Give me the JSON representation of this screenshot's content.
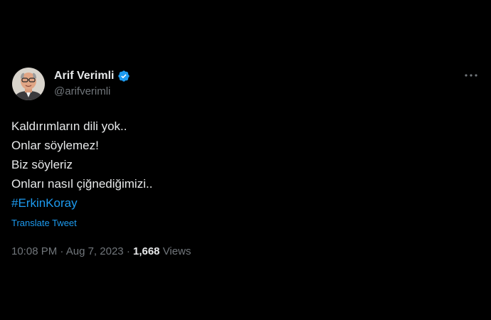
{
  "author": {
    "display_name": "Arif Verimli",
    "handle": "@arifverimli",
    "verified_icon": "verified-badge-icon",
    "verified_color": "#1d9bf0"
  },
  "tweet": {
    "lines": [
      "Kaldırımların dili yok..",
      "Onlar söylemez!",
      "Biz söyleriz",
      "Onları nasıl çiğnediğimizi.."
    ],
    "hashtag": "#ErkinKoray",
    "translate_label": "Translate Tweet"
  },
  "meta": {
    "time": "10:08 PM",
    "separator": "·",
    "date": "Aug 7, 2023",
    "views_count": "1,668",
    "views_label": "Views"
  },
  "colors": {
    "background": "#000000",
    "text": "#e7e9ea",
    "secondary": "#71767b",
    "accent": "#1d9bf0"
  },
  "icons": {
    "more": "more-options-icon",
    "avatar": "avatar"
  }
}
